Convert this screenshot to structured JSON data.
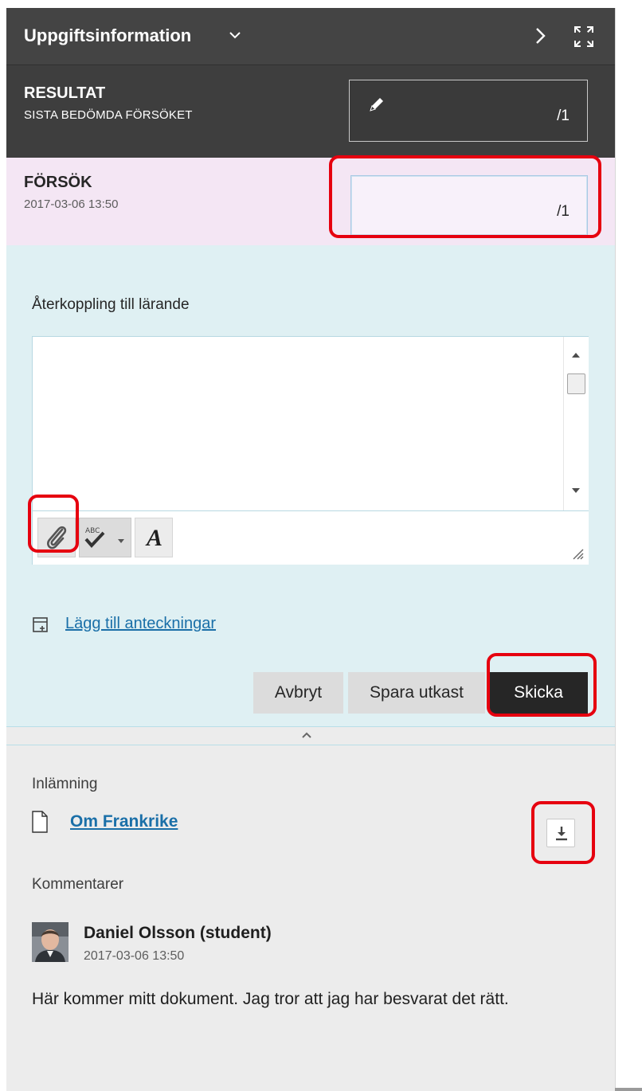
{
  "header": {
    "title": "Uppgiftsinformation",
    "caret_icon": "chevron-down-icon",
    "next_icon": "chevron-right-icon",
    "expand_icon": "expand-icon"
  },
  "result": {
    "title": "RESULTAT",
    "subtitle": "SISTA BEDÖMDA FÖRSÖKET",
    "score": "/1",
    "edit_icon": "pencil-icon"
  },
  "attempt": {
    "title": "FÖRSÖK",
    "date": "2017-03-06 13:50",
    "score": "/1"
  },
  "feedback": {
    "label": "Återkoppling till lärande",
    "text": "",
    "toolbar": {
      "attach_icon": "paperclip-icon",
      "spellcheck_icon": "spellcheck-icon",
      "font_icon": "text-format-icon",
      "font_glyph": "A"
    },
    "notes_link": "Lägg till anteckningar",
    "buttons": {
      "cancel": "Avbryt",
      "save_draft": "Spara utkast",
      "submit": "Skicka"
    }
  },
  "submission": {
    "label": "Inlämning",
    "file_name": "Om Frankrike",
    "download_icon": "download-icon"
  },
  "comments": {
    "label": "Kommentarer",
    "items": [
      {
        "author": "Daniel Olsson (student)",
        "date": "2017-03-06 13:50",
        "text": "Här kommer mitt dokument. Jag tror att jag har besvarat det rätt."
      }
    ]
  },
  "colors": {
    "header_bg": "#444444",
    "attempt_bg": "#f4e6f4",
    "feedback_bg": "#dff0f3",
    "link": "#1a6fa8",
    "highlight": "#e6000f",
    "primary_button": "#262626"
  }
}
